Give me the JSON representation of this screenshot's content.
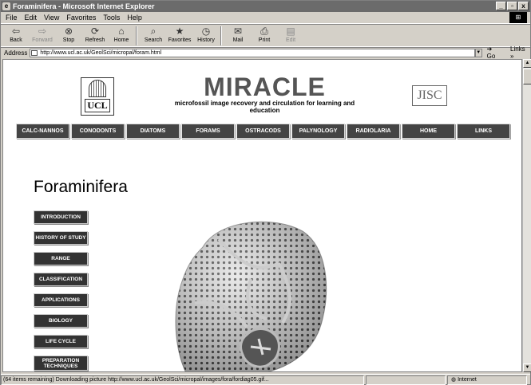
{
  "window": {
    "title": "Foraminifera - Microsoft Internet Explorer",
    "icon": "ie-icon",
    "controls": [
      "_",
      "▫",
      "x"
    ]
  },
  "menu": [
    "File",
    "Edit",
    "View",
    "Favorites",
    "Tools",
    "Help"
  ],
  "toolbar": [
    {
      "label": "Back",
      "icon": "back-arrow-icon",
      "glyph": "⇦",
      "enabled": true
    },
    {
      "label": "Forward",
      "icon": "forward-arrow-icon",
      "glyph": "⇨",
      "enabled": false
    },
    {
      "label": "Stop",
      "icon": "stop-icon",
      "glyph": "⊗",
      "enabled": true
    },
    {
      "label": "Refresh",
      "icon": "refresh-icon",
      "glyph": "⟳",
      "enabled": true
    },
    {
      "label": "Home",
      "icon": "home-icon",
      "glyph": "⌂",
      "enabled": true
    },
    {
      "label": "Search",
      "icon": "search-icon",
      "glyph": "⌕",
      "enabled": true
    },
    {
      "label": "Favorites",
      "icon": "favorites-icon",
      "glyph": "★",
      "enabled": true
    },
    {
      "label": "History",
      "icon": "history-icon",
      "glyph": "◷",
      "enabled": true
    },
    {
      "label": "Mail",
      "icon": "mail-icon",
      "glyph": "✉",
      "enabled": true
    },
    {
      "label": "Print",
      "icon": "print-icon",
      "glyph": "⎙",
      "enabled": true
    },
    {
      "label": "Edit",
      "icon": "edit-icon",
      "glyph": "▤",
      "enabled": false
    }
  ],
  "address": {
    "label": "Address",
    "url": "http://www.ucl.ac.uk/GeolSci/micropal/foram.html",
    "go": "Go",
    "links": "Links »"
  },
  "page": {
    "ucl_logo": "UCL",
    "title": "MIRACLE",
    "subtitle": "microfossil image recovery and circulation for learning and education",
    "jisc_logo": "JISC",
    "nav": [
      "CALC-NANNOS",
      "CONODONTS",
      "DIATOMS",
      "FORAMS",
      "OSTRACODS",
      "PALYNOLOGY",
      "RADIOLARIA",
      "HOME",
      "LINKS"
    ],
    "heading": "Foraminifera",
    "sidenav": [
      "INTRODUCTION",
      "HISTORY OF STUDY",
      "RANGE",
      "CLASSIFICATION",
      "APPLICATIONS",
      "BIOLOGY",
      "LIFE CYCLE",
      "PREPARATION TECHNIQUES"
    ]
  },
  "status": {
    "text": "(64 items remaining) Downloading picture http://www.ucl.ac.uk/GeolSci/micropal/images/fora/fordiag05.gif...",
    "zone": "Internet"
  }
}
